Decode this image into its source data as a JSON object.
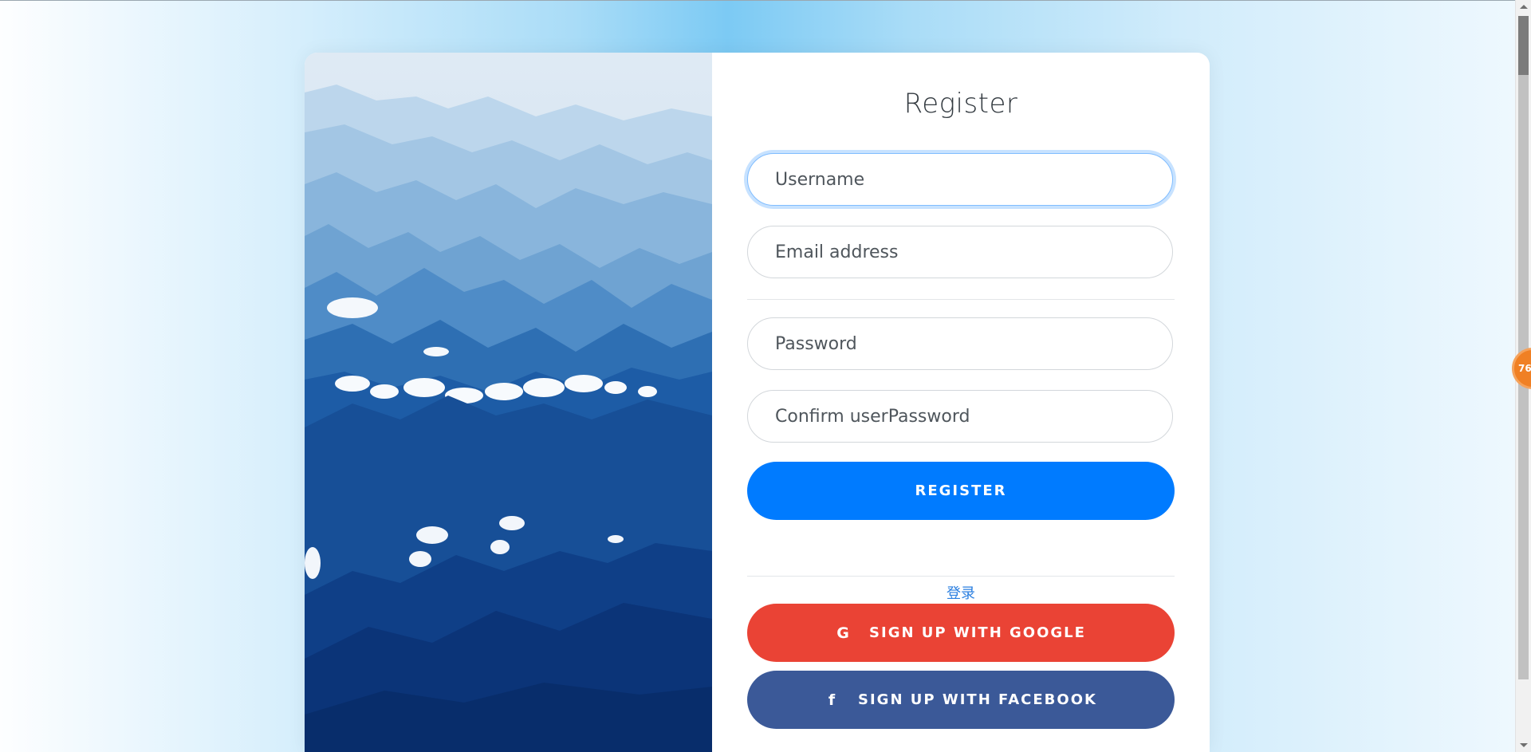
{
  "form": {
    "title": "Register",
    "username_placeholder": "Username",
    "email_placeholder": "Email address",
    "password_placeholder": "Password",
    "confirm_placeholder": "Confirm userPassword",
    "register_label": "REGISTER",
    "login_link": "登录",
    "google_label": "SIGN UP WITH GOOGLE",
    "facebook_label": "SIGN UP WITH FACEBOOK",
    "google_icon": "G",
    "facebook_icon": "f"
  },
  "badge": {
    "text": "76"
  },
  "colors": {
    "primary": "#007bff",
    "google": "#ea4335",
    "facebook": "#3b5998",
    "link": "#2b7fe0"
  },
  "icons": {
    "google": "google-icon",
    "facebook": "facebook-icon"
  }
}
